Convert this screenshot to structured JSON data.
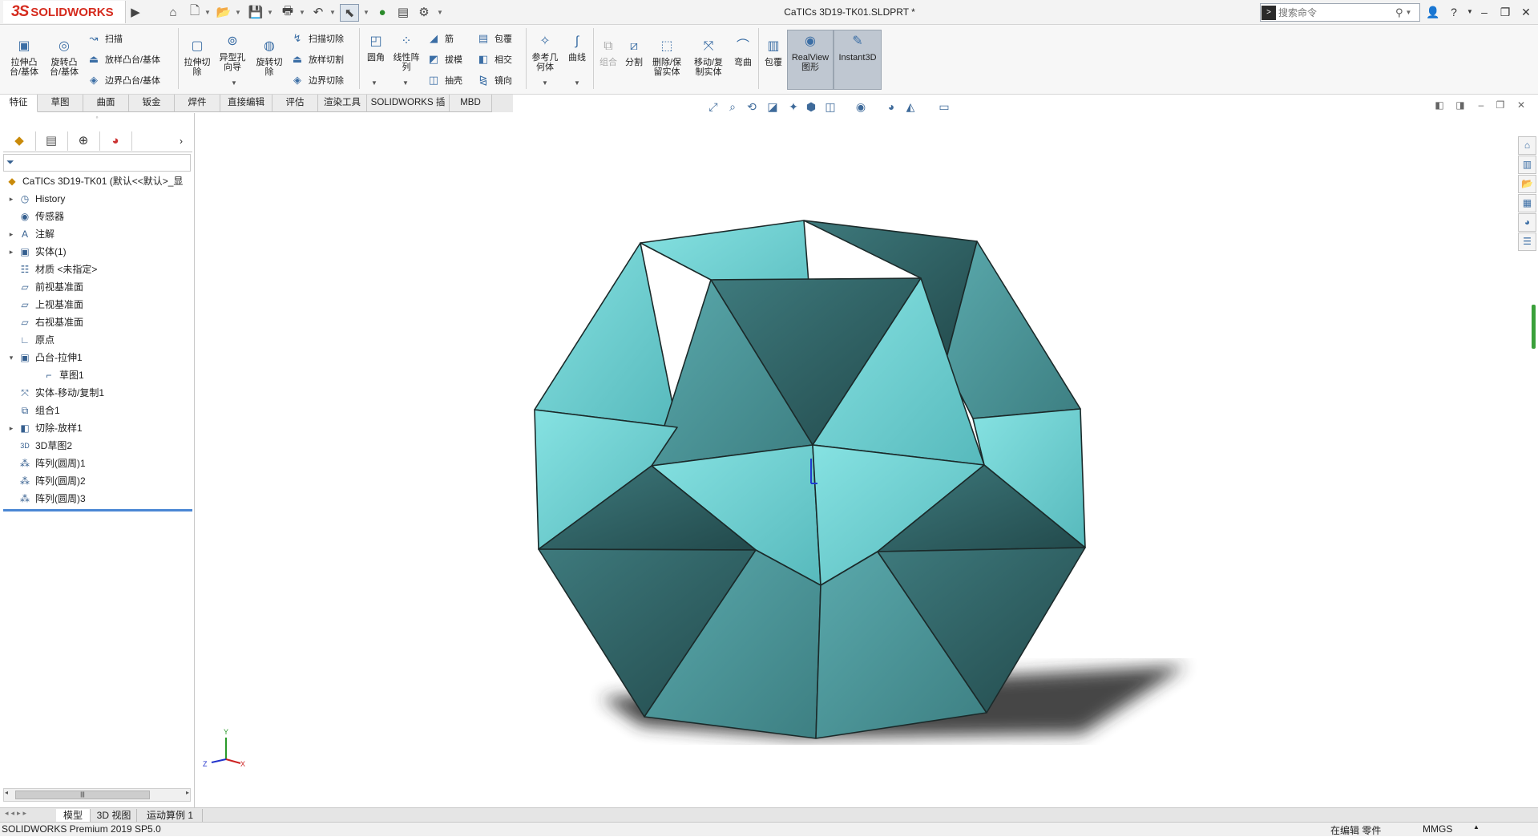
{
  "app": {
    "logo_ds": "3S",
    "logo_name": "SOLIDWORKS",
    "document_title": "CaTICs 3D19-TK01.SLDPRT *",
    "search_placeholder": "搜索命令"
  },
  "quick_access": {
    "icons": [
      "home-icon",
      "new-document-icon",
      "open-icon",
      "save-icon",
      "print-icon",
      "undo-icon",
      "select-icon",
      "traffic-light-icon",
      "options-icon",
      "gear-icon"
    ]
  },
  "window_controls": [
    "user-icon",
    "help-icon",
    "minimize-icon",
    "restore-icon",
    "close-icon"
  ],
  "ribbon": {
    "extrude_boss": "拉伸凸\n台/基体",
    "revolve_boss": "旋转凸\n台/基体",
    "sweep": "扫描",
    "loft_boss": "放样凸台/基体",
    "boundary_boss": "边界凸台/基体",
    "extrude_cut": "拉伸切\n除",
    "hole_wizard": "异型孔\n向导",
    "revolve_cut": "旋转切\n除",
    "sweep_cut": "扫描切除",
    "loft_cut": "放样切割",
    "boundary_cut": "边界切除",
    "fillet": "圆角",
    "linear_pattern": "线性阵\n列",
    "rib": "筋",
    "draft": "拔模",
    "shell": "抽壳",
    "wrap": "包覆",
    "intersect": "相交",
    "mirror": "镜向",
    "reference_geometry": "参考几\n何体",
    "curves": "曲线",
    "combine": "组合",
    "split": "分割",
    "delete_keep_body": "删除/保\n留实体",
    "move_copy_body": "移动/复\n制实体",
    "flex": "弯曲",
    "wrap2": "包覆",
    "realview": "RealView\n图形",
    "instant3d": "Instant3D"
  },
  "tabs": [
    "特征",
    "草图",
    "曲面",
    "钣金",
    "焊件",
    "直接编辑",
    "评估",
    "渲染工具",
    "SOLIDWORKS 插件",
    "MBD"
  ],
  "active_tab": "特征",
  "feature_tree": {
    "root": "CaTICs 3D19-TK01  (默认<<默认>_显",
    "items": [
      {
        "label": "History",
        "icon": "history-icon",
        "expand": "▸"
      },
      {
        "label": "传感器",
        "icon": "sensor-icon",
        "expand": ""
      },
      {
        "label": "注解",
        "icon": "annotation-icon",
        "expand": "▸"
      },
      {
        "label": "实体(1)",
        "icon": "solid-body-icon",
        "expand": "▸"
      },
      {
        "label": "材质 <未指定>",
        "icon": "material-icon",
        "expand": ""
      },
      {
        "label": "前视基准面",
        "icon": "plane-icon",
        "expand": ""
      },
      {
        "label": "上视基准面",
        "icon": "plane-icon",
        "expand": ""
      },
      {
        "label": "右视基准面",
        "icon": "plane-icon",
        "expand": ""
      },
      {
        "label": "原点",
        "icon": "origin-icon",
        "expand": ""
      },
      {
        "label": "凸台-拉伸1",
        "icon": "extrude-icon",
        "expand": "▾"
      },
      {
        "label": "草图1",
        "icon": "sketch-icon",
        "expand": ""
      },
      {
        "label": "实体-移动/复制1",
        "icon": "move-copy-icon",
        "expand": ""
      },
      {
        "label": "组合1",
        "icon": "combine-icon",
        "expand": ""
      },
      {
        "label": "切除-放样1",
        "icon": "loft-cut-icon",
        "expand": "▸"
      },
      {
        "label": "3D草图2",
        "icon": "3d-sketch-icon",
        "expand": ""
      },
      {
        "label": "阵列(圆周)1",
        "icon": "circular-pattern-icon",
        "expand": ""
      },
      {
        "label": "阵列(圆周)2",
        "icon": "circular-pattern-icon",
        "expand": ""
      },
      {
        "label": "阵列(圆周)3",
        "icon": "circular-pattern-icon",
        "expand": ""
      }
    ]
  },
  "bottom_tabs": [
    "模型",
    "3D 视图",
    "运动算例 1"
  ],
  "status": {
    "product": "SOLIDWORKS Premium 2019 SP5.0",
    "mode": "在编辑 零件",
    "units": "MMGS"
  },
  "triad": {
    "x": "X",
    "y": "Y",
    "z": "Z"
  },
  "colors": {
    "accent": "#d52b1e",
    "model_light": "#6fd0d2",
    "model_dark": "#2f5f62",
    "selection": "#4a87d4"
  }
}
